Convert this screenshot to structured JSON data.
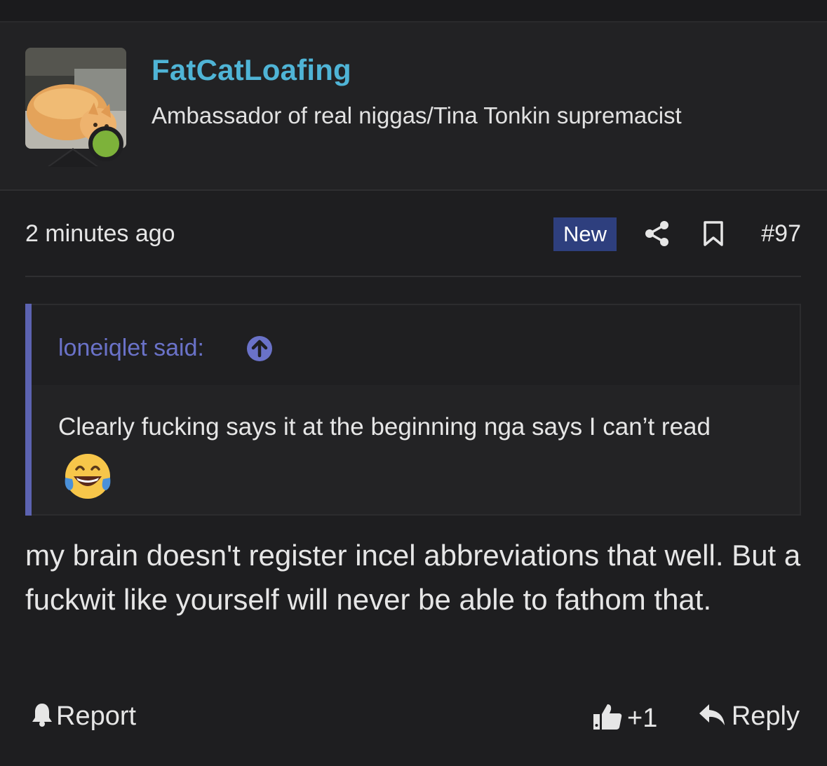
{
  "user": {
    "name": "FatCatLoafing",
    "title": "Ambassador of real niggas/Tina Tonkin supremacist",
    "avatar_icon": "cat-loaf-avatar",
    "online_status_color": "#7db23a"
  },
  "post": {
    "timestamp": "2 minutes ago",
    "badge": "New",
    "number": "#97"
  },
  "quote": {
    "author": "loneiqlet said:",
    "text": "Clearly fucking says it at the beginning nga says I can’t read",
    "emoji": "face-with-tears-of-joy"
  },
  "message": {
    "text": "my brain doesn't register incel abbreviations that well. But a fuckwit like yourself will never be able to fathom that."
  },
  "footer": {
    "report_label": "Report",
    "like_count": "+1",
    "reply_label": "Reply"
  },
  "colors": {
    "background": "#1e1e20",
    "username": "#4fb4d6",
    "badge_bg": "#2e3f7e",
    "quote_accent": "#5c63b1"
  }
}
